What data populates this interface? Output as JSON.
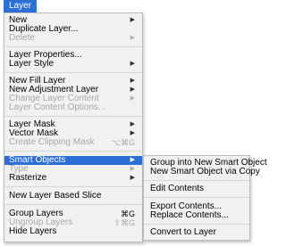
{
  "menubar": {
    "title": "Layer"
  },
  "menu": {
    "new": {
      "label": "New",
      "arrow": "▶"
    },
    "duplicate_layer": {
      "label": "Duplicate Layer..."
    },
    "delete": {
      "label": "Delete",
      "arrow": "▶"
    },
    "layer_properties": {
      "label": "Layer Properties..."
    },
    "layer_style": {
      "label": "Layer Style",
      "arrow": "▶"
    },
    "new_fill_layer": {
      "label": "New Fill Layer",
      "arrow": "▶"
    },
    "new_adjustment_layer": {
      "label": "New Adjustment Layer",
      "arrow": "▶"
    },
    "change_layer_content": {
      "label": "Change Layer Content",
      "arrow": "▶"
    },
    "layer_content_options": {
      "label": "Layer Content Options..."
    },
    "layer_mask": {
      "label": "Layer Mask",
      "arrow": "▶"
    },
    "vector_mask": {
      "label": "Vector Mask",
      "arrow": "▶"
    },
    "create_clipping_mask": {
      "label": "Create Clipping Mask",
      "shortcut": "⌥⌘G"
    },
    "smart_objects": {
      "label": "Smart Objects",
      "arrow": "▶"
    },
    "type": {
      "label": "Type",
      "arrow": "▶"
    },
    "rasterize": {
      "label": "Rasterize",
      "arrow": "▶"
    },
    "new_layer_based_slice": {
      "label": "New Layer Based Slice"
    },
    "group_layers": {
      "label": "Group Layers",
      "shortcut": "⌘G"
    },
    "ungroup_layers": {
      "label": "Ungroup Layers",
      "shortcut": "⇧⌘G"
    },
    "hide_layers": {
      "label": "Hide Layers"
    }
  },
  "submenu": {
    "group_into_new_smart_object": "Group into New Smart Object",
    "new_smart_object_via_copy": "New Smart Object via Copy",
    "edit_contents": "Edit Contents",
    "export_contents": "Export Contents...",
    "replace_contents": "Replace Contents...",
    "convert_to_layer": "Convert to Layer"
  },
  "colors": {
    "highlight": "#2c6fd6",
    "menu_background": "#f1f1f1",
    "disabled_text": "#a8a8a8"
  }
}
